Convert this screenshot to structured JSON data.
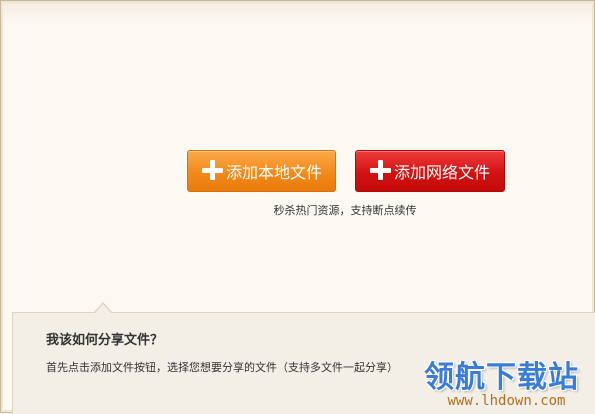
{
  "buttons": {
    "local_label": "添加本地文件",
    "network_label": "添加网络文件"
  },
  "hint": "秒杀热门资源，支持断点续传",
  "faq": {
    "title": "我该如何分享文件？",
    "text": "首先点击添加文件按钮，选择您想要分享的文件（支持多文件一起分享）"
  },
  "watermark": {
    "logo": "领航下载站",
    "url": "www.lhdown.com"
  },
  "colors": {
    "local_button": "#f28a1b",
    "network_button": "#d31212",
    "background": "#fcf9f3",
    "faq_background": "#f3efe7"
  },
  "icons": {
    "add": "plus-icon"
  }
}
